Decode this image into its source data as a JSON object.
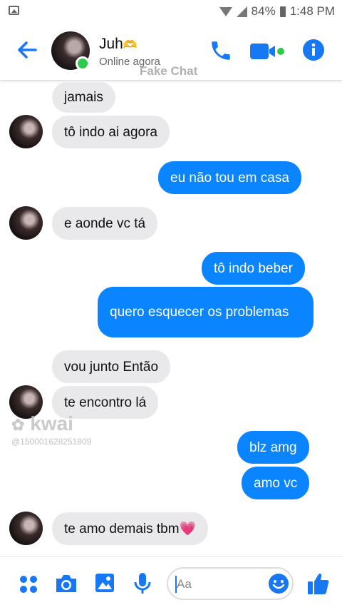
{
  "status_bar": {
    "battery": "84%",
    "time": "1:48 PM"
  },
  "header": {
    "name": "Juh",
    "name_emoji": "🫶",
    "status": "Online agora",
    "watermark": "Fake Chat"
  },
  "messages": [
    {
      "side": "in",
      "text": "jamais"
    },
    {
      "side": "in",
      "text": "tô indo ai agora"
    },
    {
      "side": "out",
      "text": "eu não tou em casa"
    },
    {
      "side": "in",
      "text": "e aonde vc tá"
    },
    {
      "side": "out",
      "text": "tô indo beber"
    },
    {
      "side": "out",
      "text": "quero esquecer os problemas"
    },
    {
      "side": "in",
      "text": "vou junto Então"
    },
    {
      "side": "in",
      "text": "te encontro lá"
    },
    {
      "side": "out",
      "text": "blz amg"
    },
    {
      "side": "out",
      "text": "amo vc"
    },
    {
      "side": "in",
      "text": "te amo demais tbm",
      "emoji": "💗"
    }
  ],
  "overlay": {
    "app_watermark": "kwai",
    "app_id": "@150001628251809"
  },
  "composer": {
    "placeholder": "Aa"
  },
  "colors": {
    "accent": "#1877f2",
    "outgoing": "#0a84ff",
    "incoming": "#e9e9eb",
    "online": "#2fca4c"
  }
}
